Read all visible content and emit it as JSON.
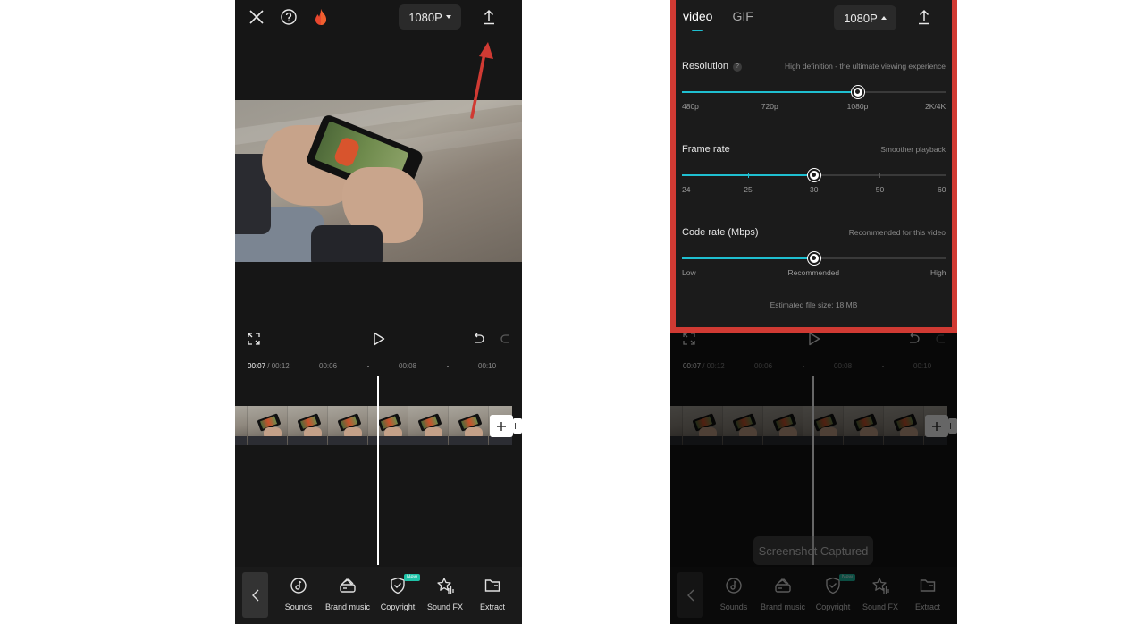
{
  "left_screen": {
    "topbar": {
      "close_icon": "close-icon",
      "help_icon": "help-icon",
      "hot_icon": "flame-icon",
      "resolution_label": "1080P",
      "export_icon": "upload-icon"
    },
    "controls": {
      "fullscreen_icon": "fullscreen-icon",
      "play_icon": "play-icon",
      "undo_icon": "undo-icon",
      "redo_icon": "redo-icon"
    },
    "timeline": {
      "current_time": "00:07",
      "separator": " / ",
      "total_time": "00:12",
      "markers": [
        "00:06",
        "00:08",
        "00:10"
      ]
    },
    "toolbar": {
      "back_icon": "chevron-left-icon",
      "items": [
        {
          "label": "Sounds",
          "icon": "music-note-icon"
        },
        {
          "label": "Brand music",
          "icon": "brand-music-icon"
        },
        {
          "label": "Copyright",
          "icon": "shield-check-icon",
          "badge": "New"
        },
        {
          "label": "Sound FX",
          "icon": "star-sound-icon"
        },
        {
          "label": "Extract",
          "icon": "folder-icon"
        }
      ]
    },
    "annotation": {
      "arrow_color": "#d03a33"
    }
  },
  "right_screen": {
    "export_panel": {
      "tabs": [
        {
          "label": "video",
          "active": true
        },
        {
          "label": "GIF",
          "active": false
        }
      ],
      "resolution_label": "1080P",
      "export_icon": "upload-icon",
      "resolution": {
        "title": "Resolution",
        "help": "?",
        "hint": "High definition - the ultimate viewing experience",
        "options": [
          "480p",
          "720p",
          "1080p",
          "2K/4K"
        ],
        "selected": "1080p"
      },
      "frame_rate": {
        "title": "Frame rate",
        "hint": "Smoother playback",
        "options": [
          "24",
          "25",
          "30",
          "50",
          "60"
        ],
        "selected": "30"
      },
      "code_rate": {
        "title": "Code rate (Mbps)",
        "hint": "Recommended for this video",
        "options": [
          "Low",
          "Recommended",
          "High"
        ],
        "selected": "Recommended"
      },
      "estimated_size": "Estimated file size: 18 MB",
      "highlight_color": "#d03a33",
      "accent_color": "#1fbfd0"
    },
    "timeline": {
      "current_time": "00:07",
      "separator": " / ",
      "total_time": "00:12",
      "markers": [
        "00:06",
        "00:08",
        "00:10"
      ]
    },
    "toast": "Screenshot Captured",
    "toolbar": {
      "items": [
        {
          "label": "Sounds"
        },
        {
          "label": "Brand music"
        },
        {
          "label": "Copyright",
          "badge": "New"
        },
        {
          "label": "Sound FX"
        },
        {
          "label": "Extract"
        }
      ]
    }
  }
}
